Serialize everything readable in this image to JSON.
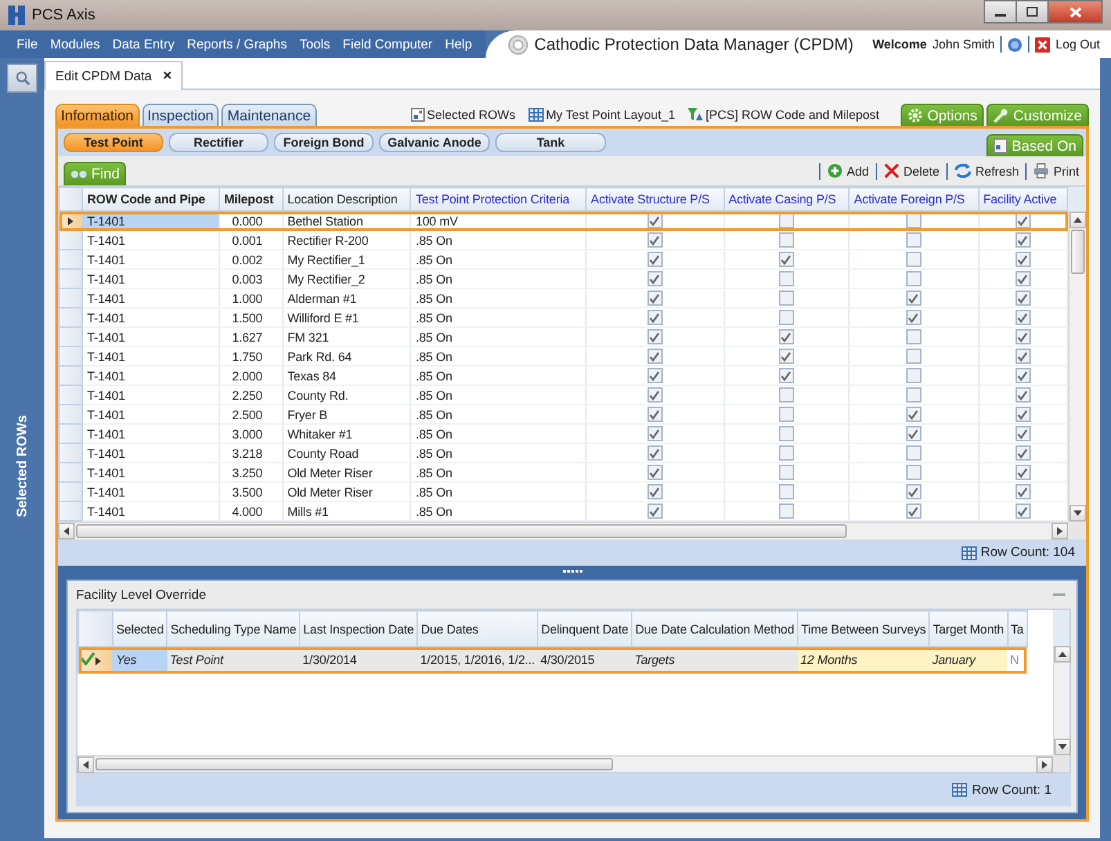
{
  "window": {
    "title": "PCS Axis"
  },
  "menu": [
    "File",
    "Modules",
    "Data Entry",
    "Reports / Graphs",
    "Tools",
    "Field Computer",
    "Help"
  ],
  "app_title": "Cathodic Protection Data Manager (CPDM)",
  "user": {
    "welcome": "Welcome",
    "name": "John Smith",
    "logout": "Log Out"
  },
  "sidebar": {
    "label": "Selected ROWs"
  },
  "document_tabs": [
    {
      "label": "Edit CPDM Data",
      "close": "×",
      "selected": true
    }
  ],
  "module_tabs": [
    {
      "label": "Information",
      "selected": true
    },
    {
      "label": "Inspection",
      "selected": false
    },
    {
      "label": "Maintenance",
      "selected": false
    }
  ],
  "context": [
    {
      "label": "Selected ROWs",
      "kind": "selection"
    },
    {
      "label": "My Test Point Layout_1",
      "kind": "layout"
    },
    {
      "label": "[PCS] ROW Code and Milepost",
      "kind": "filter"
    }
  ],
  "actions": [
    {
      "label": "Options",
      "kind": "options"
    },
    {
      "label": "Customize",
      "kind": "customize"
    }
  ],
  "facility_tabs": [
    {
      "label": "Test Point",
      "selected": true
    },
    {
      "label": "Rectifier",
      "selected": false
    },
    {
      "label": "Foreign Bond",
      "selected": false
    },
    {
      "label": "Galvanic Anode",
      "selected": false
    },
    {
      "label": "Tank",
      "selected": false
    }
  ],
  "based_on": "Based On",
  "find": "Find",
  "toolbar": [
    {
      "label": "Add",
      "kind": "add"
    },
    {
      "label": "Delete",
      "kind": "delete"
    },
    {
      "label": "Refresh",
      "kind": "refresh"
    },
    {
      "label": "Print",
      "kind": "print"
    }
  ],
  "table": {
    "columns": [
      {
        "label": "ROW Code and Pipe",
        "kind": "text"
      },
      {
        "label": "Milepost",
        "kind": "text"
      },
      {
        "label": "Location Description",
        "kind": "text"
      },
      {
        "label": "Test Point Protection Criteria",
        "kind": "text"
      },
      {
        "label": "Activate Structure P/S",
        "kind": "check"
      },
      {
        "label": "Activate Casing P/S",
        "kind": "check"
      },
      {
        "label": "Activate Foreign P/S",
        "kind": "check"
      },
      {
        "label": "Facility Active",
        "kind": "check"
      }
    ],
    "rows": [
      {
        "selected": true,
        "values": [
          "T-1401",
          "0.000",
          "Bethel Station",
          "100 mV",
          true,
          false,
          false,
          true
        ]
      },
      {
        "selected": false,
        "values": [
          "T-1401",
          "0.001",
          "Rectifier R-200",
          ".85 On",
          true,
          false,
          false,
          true
        ]
      },
      {
        "selected": false,
        "values": [
          "T-1401",
          "0.002",
          "My Rectifier_1",
          ".85 On",
          true,
          true,
          false,
          true
        ]
      },
      {
        "selected": false,
        "values": [
          "T-1401",
          "0.003",
          "My Rectifier_2",
          ".85 On",
          true,
          false,
          false,
          true
        ]
      },
      {
        "selected": false,
        "values": [
          "T-1401",
          "1.000",
          "Alderman #1",
          ".85 On",
          true,
          false,
          true,
          true
        ]
      },
      {
        "selected": false,
        "values": [
          "T-1401",
          "1.500",
          "Williford E #1",
          ".85 On",
          true,
          false,
          true,
          true
        ]
      },
      {
        "selected": false,
        "values": [
          "T-1401",
          "1.627",
          "FM 321",
          ".85 On",
          true,
          true,
          false,
          true
        ]
      },
      {
        "selected": false,
        "values": [
          "T-1401",
          "1.750",
          "Park Rd. 64",
          ".85 On",
          true,
          true,
          false,
          true
        ]
      },
      {
        "selected": false,
        "values": [
          "T-1401",
          "2.000",
          "Texas 84",
          ".85 On",
          true,
          true,
          false,
          true
        ]
      },
      {
        "selected": false,
        "values": [
          "T-1401",
          "2.250",
          "County Rd.",
          ".85 On",
          true,
          false,
          false,
          true
        ]
      },
      {
        "selected": false,
        "values": [
          "T-1401",
          "2.500",
          "Fryer B",
          ".85 On",
          true,
          false,
          true,
          true
        ]
      },
      {
        "selected": false,
        "values": [
          "T-1401",
          "3.000",
          "Whitaker #1",
          ".85 On",
          true,
          false,
          true,
          true
        ]
      },
      {
        "selected": false,
        "values": [
          "T-1401",
          "3.218",
          "County Road",
          ".85 On",
          true,
          false,
          false,
          true
        ]
      },
      {
        "selected": false,
        "values": [
          "T-1401",
          "3.250",
          "Old Meter Riser",
          ".85 On",
          true,
          false,
          false,
          true
        ]
      },
      {
        "selected": false,
        "values": [
          "T-1401",
          "3.500",
          "Old Meter Riser",
          ".85 On",
          true,
          false,
          true,
          true
        ]
      },
      {
        "selected": false,
        "values": [
          "T-1401",
          "4.000",
          "Mills #1",
          ".85 On",
          true,
          false,
          true,
          true
        ]
      }
    ],
    "row_count_label": "Row Count:",
    "row_count": "104"
  },
  "override": {
    "title": "Facility Level Override",
    "columns": [
      "Selected",
      "Scheduling Type Name",
      "Last Inspection Date",
      "Due Dates",
      "Delinquent Date",
      "Due Date Calculation Method",
      "Time Between Surveys",
      "Target Month",
      "Ta"
    ],
    "rows": [
      {
        "selected": true,
        "saved": true,
        "cells": [
          "Yes",
          "Test Point",
          "1/30/2014",
          "1/2015, 1/2016, 1/2...",
          "4/30/2015",
          "Targets",
          "12 Months",
          "January",
          "N"
        ]
      }
    ],
    "row_count_label": "Row Count:",
    "row_count": "1"
  }
}
